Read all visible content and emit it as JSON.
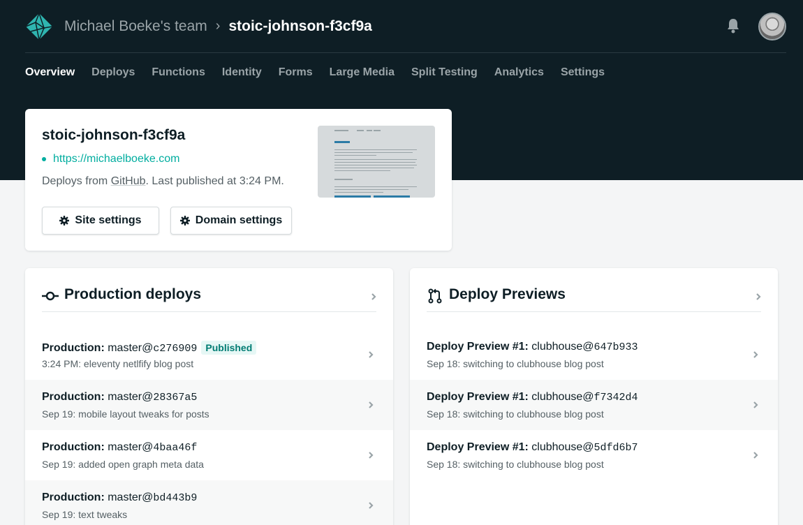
{
  "header": {
    "team": "Michael Boeke's team",
    "separator": "›",
    "site": "stoic-johnson-f3cf9a",
    "icons": [
      "netlify-logo-icon",
      "bell-icon",
      "avatar"
    ]
  },
  "nav": {
    "items": [
      {
        "label": "Overview",
        "active": true
      },
      {
        "label": "Deploys"
      },
      {
        "label": "Functions"
      },
      {
        "label": "Identity"
      },
      {
        "label": "Forms"
      },
      {
        "label": "Large Media"
      },
      {
        "label": "Split Testing"
      },
      {
        "label": "Analytics"
      },
      {
        "label": "Settings"
      }
    ]
  },
  "site_card": {
    "title": "stoic-johnson-f3cf9a",
    "url": "https://michaelboeke.com",
    "deploys_prefix": "Deploys from ",
    "provider": "GitHub",
    "deploys_suffix": ". Last published at 3:24 PM.",
    "site_settings": "Site settings",
    "domain_settings": "Domain settings"
  },
  "production": {
    "title": "Production deploys",
    "rows": [
      {
        "prefix": "Production:",
        "branch": "master@",
        "hash": "c276909",
        "badge": "Published",
        "subtitle": "3:24 PM: eleventy netlfify blog post"
      },
      {
        "prefix": "Production:",
        "branch": "master@",
        "hash": "28367a5",
        "subtitle": "Sep 19: mobile layout tweaks for posts"
      },
      {
        "prefix": "Production:",
        "branch": "master@",
        "hash": "4baa46f",
        "subtitle": "Sep 19: added open graph meta data"
      },
      {
        "prefix": "Production:",
        "branch": "master@",
        "hash": "bd443b9",
        "subtitle": "Sep 19: text tweaks"
      }
    ]
  },
  "previews": {
    "title": "Deploy Previews",
    "rows": [
      {
        "prefix": "Deploy Preview #1:",
        "branch": "clubhouse@",
        "hash": "647b933",
        "subtitle": "Sep 18: switching to clubhouse blog post"
      },
      {
        "prefix": "Deploy Preview #1:",
        "branch": "clubhouse@",
        "hash": "f7342d4",
        "subtitle": "Sep 18: switching to clubhouse blog post"
      },
      {
        "prefix": "Deploy Preview #1:",
        "branch": "clubhouse@",
        "hash": "5dfd6b7",
        "subtitle": "Sep 18: switching to clubhouse blog post"
      }
    ]
  },
  "colors": {
    "header_bg": "#0e1e25",
    "accent": "#00ad9f",
    "page_bg": "#f4f5f6"
  }
}
